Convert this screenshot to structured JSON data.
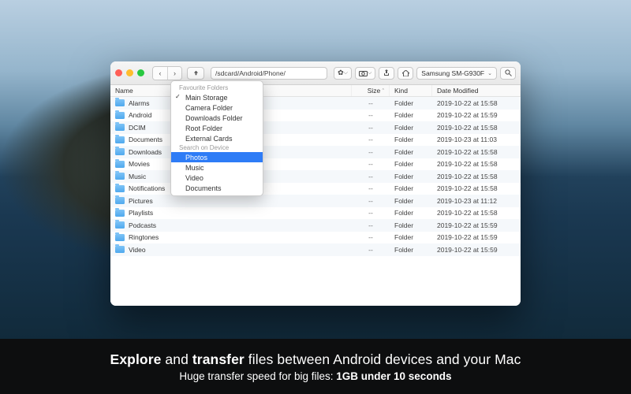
{
  "path": "/sdcard/Android/Phone/",
  "device_label": "Samsung SM-G930F",
  "columns": {
    "name": "Name",
    "size": "Size",
    "kind": "Kind",
    "date": "Date Modified"
  },
  "dropdown": {
    "section1_title": "Favourite Folders",
    "section1": [
      "Main Storage",
      "Camera Folder",
      "Downloads Folder",
      "Root Folder",
      "External Cards"
    ],
    "checked": "Main Storage",
    "section2_title": "Search on Device",
    "section2": [
      "Photos",
      "Music",
      "Video",
      "Documents"
    ],
    "selected": "Photos"
  },
  "files": [
    {
      "name": "Alarms",
      "size": "--",
      "kind": "Folder",
      "date": "2019-10-22 at 15:58"
    },
    {
      "name": "Android",
      "size": "--",
      "kind": "Folder",
      "date": "2019-10-22 at 15:59"
    },
    {
      "name": "DCIM",
      "size": "--",
      "kind": "Folder",
      "date": "2019-10-22 at 15:58"
    },
    {
      "name": "Documents",
      "size": "--",
      "kind": "Folder",
      "date": "2019-10-23 at 11:03"
    },
    {
      "name": "Downloads",
      "size": "--",
      "kind": "Folder",
      "date": "2019-10-22 at 15:58"
    },
    {
      "name": "Movies",
      "size": "--",
      "kind": "Folder",
      "date": "2019-10-22 at 15:58"
    },
    {
      "name": "Music",
      "size": "--",
      "kind": "Folder",
      "date": "2019-10-22 at 15:58"
    },
    {
      "name": "Notifications",
      "size": "--",
      "kind": "Folder",
      "date": "2019-10-22 at 15:58"
    },
    {
      "name": "Pictures",
      "size": "--",
      "kind": "Folder",
      "date": "2019-10-23 at 11:12"
    },
    {
      "name": "Playlists",
      "size": "--",
      "kind": "Folder",
      "date": "2019-10-22 at 15:58"
    },
    {
      "name": "Podcasts",
      "size": "--",
      "kind": "Folder",
      "date": "2019-10-22 at 15:59"
    },
    {
      "name": "Ringtones",
      "size": "--",
      "kind": "Folder",
      "date": "2019-10-22 at 15:59"
    },
    {
      "name": "Video",
      "size": "--",
      "kind": "Folder",
      "date": "2019-10-22 at 15:59"
    }
  ],
  "caption": {
    "line1_a": "Explore",
    "line1_b": " and ",
    "line1_c": "transfer",
    "line1_d": " files between Android devices and your Mac",
    "line2_a": "Huge transfer speed for big files: ",
    "line2_b": "1GB under 10 seconds"
  }
}
